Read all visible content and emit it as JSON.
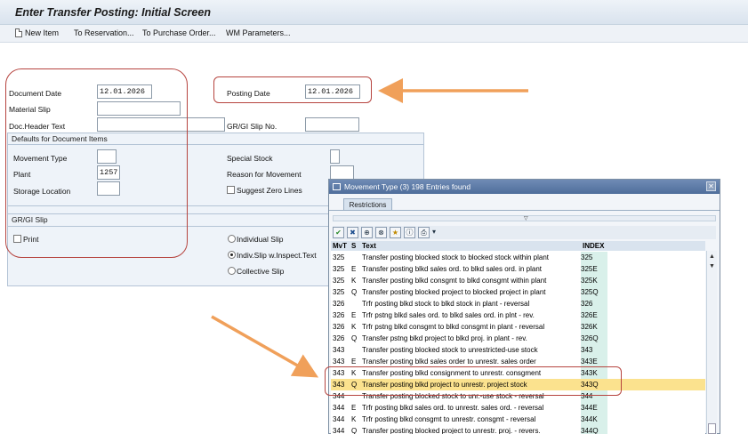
{
  "window": {
    "title": "Enter Transfer Posting: Initial Screen"
  },
  "toolbar": {
    "new_item": "New Item",
    "to_reservation": "To Reservation...",
    "to_purchase_order": "To Purchase Order...",
    "wm_parameters": "WM Parameters..."
  },
  "header": {
    "document_date_label": "Document Date",
    "document_date": "12.01.2026",
    "posting_date_label": "Posting Date",
    "posting_date": "12.01.2026",
    "material_slip_label": "Material Slip",
    "doc_header_text_label": "Doc.Header Text",
    "gr_gi_slip_no_label": "GR/GI Slip No."
  },
  "defaults": {
    "title": "Defaults for Document Items",
    "movement_type_label": "Movement Type",
    "plant_label": "Plant",
    "plant": "1257",
    "storage_location_label": "Storage Location",
    "special_stock_label": "Special Stock",
    "reason_label": "Reason for Movement",
    "suggest_zero_lines": "Suggest Zero Lines"
  },
  "slip": {
    "title": "GR/GI Slip",
    "print": "Print",
    "individual_slip": "Individual Slip",
    "indiv_inspect": "Indiv.Slip w.Inspect.Text",
    "collective_slip": "Collective Slip"
  },
  "popup": {
    "title": "Movement Type (3)",
    "entries": "198 Entries found",
    "tab_restrictions": "Restrictions",
    "columns": {
      "mvt": "MvT",
      "s": "S",
      "text": "Text",
      "index": "INDEX"
    },
    "rows": [
      {
        "mvt": "325",
        "s": "",
        "text": "Transfer posting blocked stock to blocked stock within plant",
        "index": "325"
      },
      {
        "mvt": "325",
        "s": "E",
        "text": "Transfer posting blkd sales ord. to blkd sales ord. in plant",
        "index": "325E"
      },
      {
        "mvt": "325",
        "s": "K",
        "text": "Transfer posting blkd consgmt to blkd consgmt within plant",
        "index": "325K"
      },
      {
        "mvt": "325",
        "s": "Q",
        "text": "Transfer posting blocked project to blocked project in plant",
        "index": "325Q"
      },
      {
        "mvt": "326",
        "s": "",
        "text": "Trfr posting blkd stock to blkd stock in plant - reversal",
        "index": "326"
      },
      {
        "mvt": "326",
        "s": "E",
        "text": "Trfr pstng blkd sales ord. to blkd sales ord. in plnt - rev.",
        "index": "326E"
      },
      {
        "mvt": "326",
        "s": "K",
        "text": "Trfr pstng blkd consgmt to blkd consgmt in plant - reversal",
        "index": "326K"
      },
      {
        "mvt": "326",
        "s": "Q",
        "text": "Transfer pstng blkd project to blkd proj. in plant - rev.",
        "index": "326Q"
      },
      {
        "mvt": "343",
        "s": "",
        "text": "Transfer posting blocked stock to unrestricted-use stock",
        "index": "343"
      },
      {
        "mvt": "343",
        "s": "E",
        "text": "Transfer posting blkd sales order to unrestr. sales order",
        "index": "343E"
      },
      {
        "mvt": "343",
        "s": "K",
        "text": "Transfer posting blkd consignment to unrestr. consgment",
        "index": "343K"
      },
      {
        "mvt": "343",
        "s": "Q",
        "text": "Transfer posting blkd project to unrestr. project stock",
        "index": "343Q"
      },
      {
        "mvt": "344",
        "s": "",
        "text": "Transfer posting blocked stock to unr.-use stock - reversal",
        "index": "344"
      },
      {
        "mvt": "344",
        "s": "E",
        "text": "Trfr posting blkd sales ord. to unrestr. sales ord. - reversal",
        "index": "344E"
      },
      {
        "mvt": "344",
        "s": "K",
        "text": "Trfr posting blkd consgmt to unrestr. consgmt - reversal",
        "index": "344K"
      },
      {
        "mvt": "344",
        "s": "Q",
        "text": "Transfer posting blocked project to unrestr. proj. - revers.",
        "index": "344Q"
      }
    ]
  },
  "annotation_colors": {
    "highlight_box": "#b6443f",
    "arrow": "#f0a05a",
    "selected_row": "#fbe28e"
  }
}
